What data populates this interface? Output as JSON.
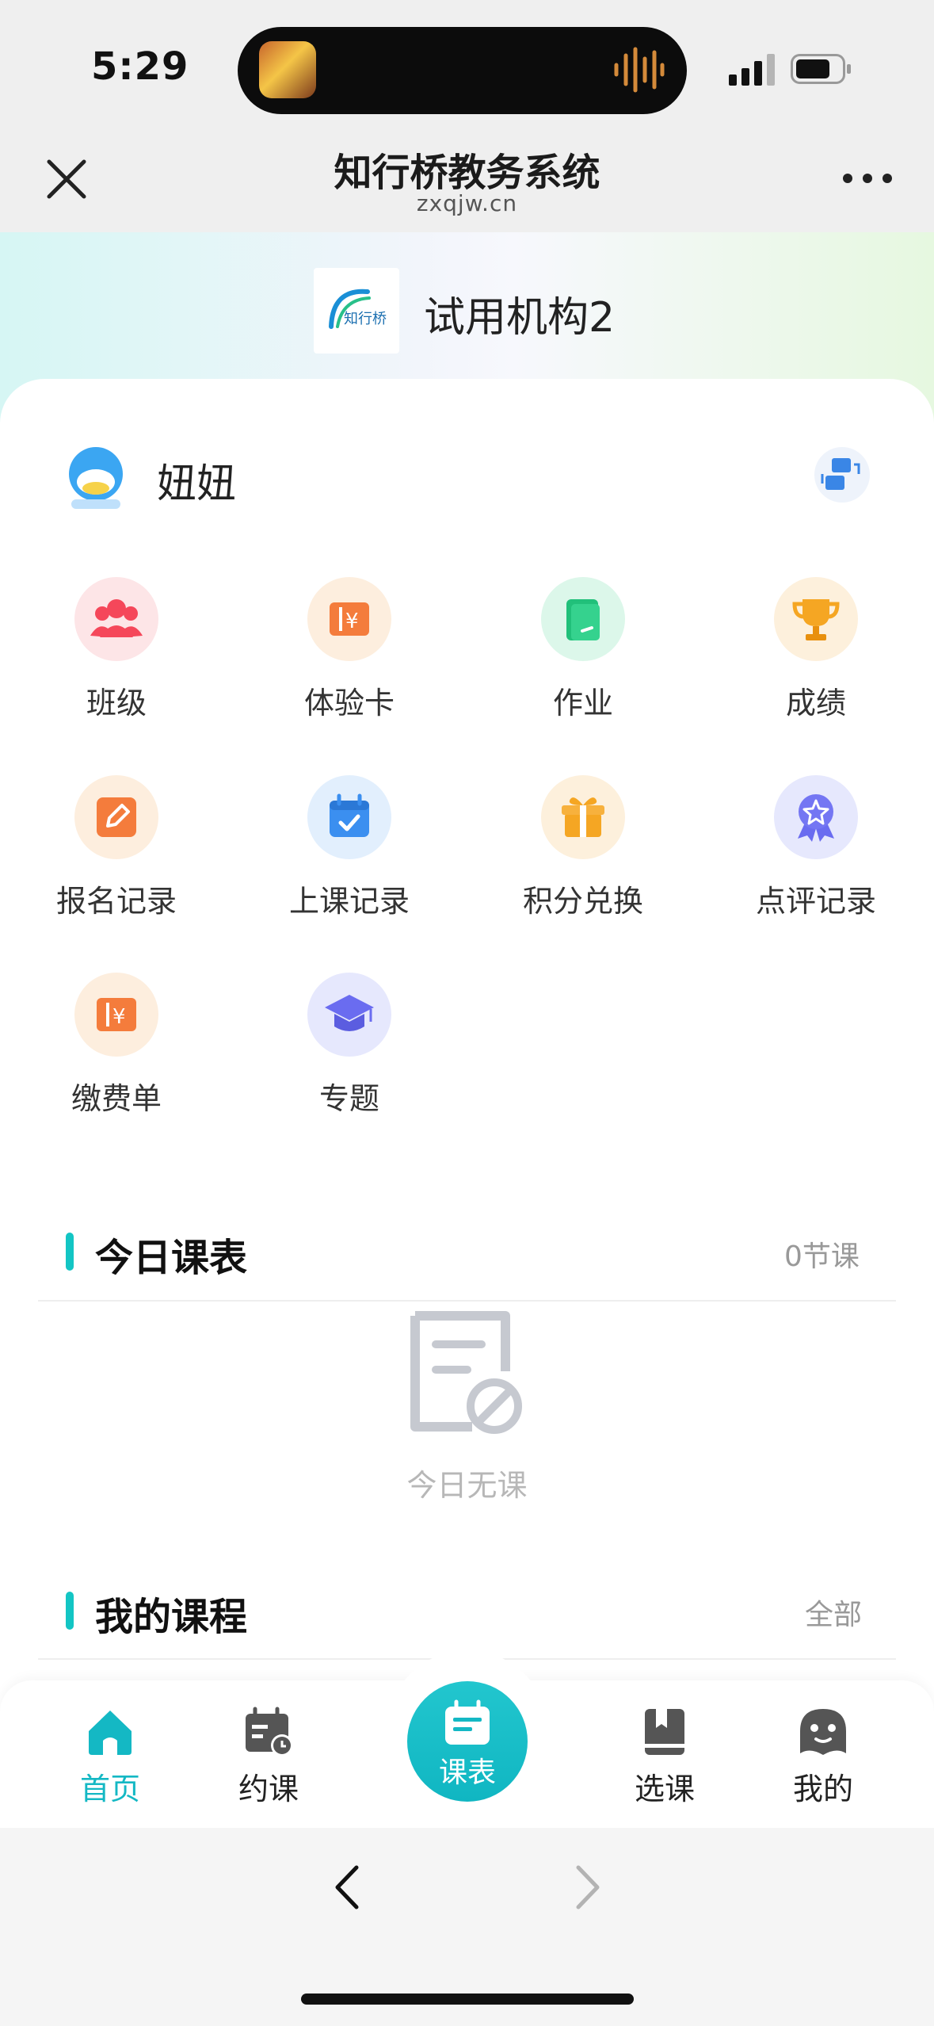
{
  "status_bar": {
    "time": "5:29"
  },
  "nav": {
    "title": "知行桥教务系统",
    "subtitle": "zxqjw.cn"
  },
  "org": {
    "name": "试用机构2",
    "logo_text": "知行桥"
  },
  "user": {
    "name": "妞妞"
  },
  "menu": [
    {
      "label": "班级",
      "icon": "people-icon",
      "color": "#f5475a"
    },
    {
      "label": "体验卡",
      "icon": "ticket-icon",
      "color": "#f47c3c"
    },
    {
      "label": "作业",
      "icon": "book-icon",
      "color": "#21c07a"
    },
    {
      "label": "成绩",
      "icon": "trophy-icon",
      "color": "#f5a623"
    },
    {
      "label": "报名记录",
      "icon": "edit-icon",
      "color": "#f47c3c"
    },
    {
      "label": "上课记录",
      "icon": "calendar-check-icon",
      "color": "#3b8ff0"
    },
    {
      "label": "积分兑换",
      "icon": "gift-icon",
      "color": "#f5a623"
    },
    {
      "label": "点评记录",
      "icon": "medal-icon",
      "color": "#6a6cf0"
    },
    {
      "label": "缴费单",
      "icon": "ticket-icon",
      "color": "#f47c3c"
    },
    {
      "label": "专题",
      "icon": "graduation-cap-icon",
      "color": "#6a6cf0"
    }
  ],
  "today_schedule": {
    "title": "今日课表",
    "count": "0节课",
    "empty_text": "今日无课"
  },
  "my_courses": {
    "title": "我的课程",
    "more": "全部"
  },
  "tabbar": [
    {
      "label": "首页",
      "active": true
    },
    {
      "label": "约课"
    },
    {
      "label": "课表"
    },
    {
      "label": "选课"
    },
    {
      "label": "我的"
    }
  ],
  "colors": {
    "accent": "#13c5c4",
    "tab_active": "#14b8c4"
  }
}
